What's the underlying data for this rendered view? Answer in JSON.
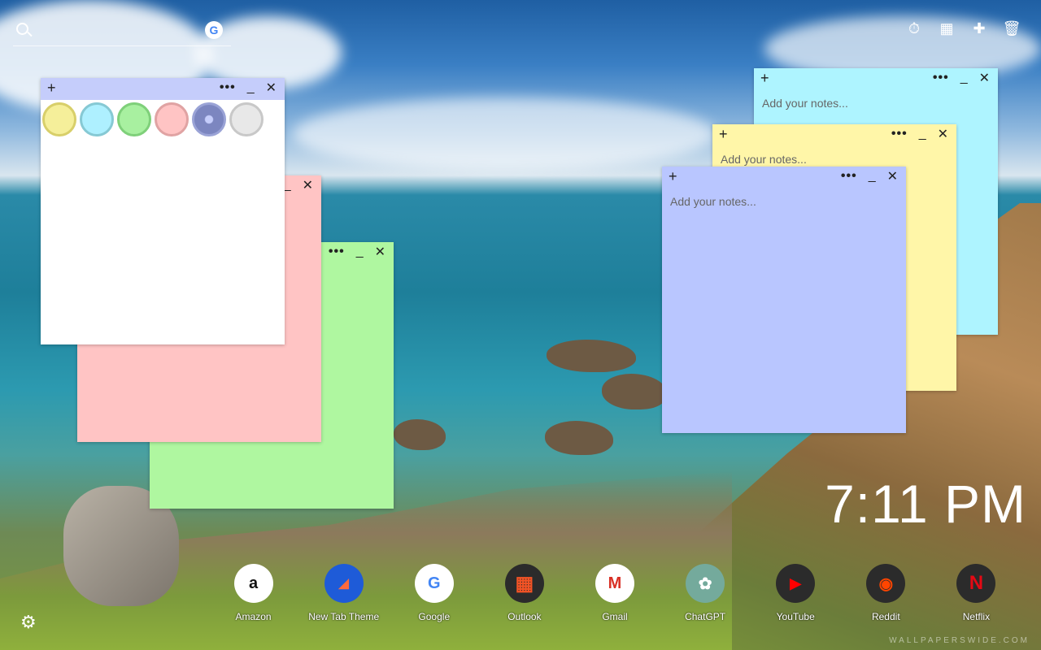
{
  "search": {
    "placeholder": ""
  },
  "top_icons": [
    "timer-icon",
    "calculator-icon",
    "new-note-icon",
    "trash-icon"
  ],
  "notes": [
    {
      "color": "#b9c6ff",
      "placeholder": "Add your notes...",
      "value": ""
    },
    {
      "color": "#fff6a8",
      "placeholder": "Add your notes...",
      "value": ""
    },
    {
      "color": "#aef4ff",
      "placeholder": "Add your notes...",
      "value": ""
    },
    {
      "color": "#aff7a0",
      "placeholder": "",
      "value": ""
    },
    {
      "color": "#ffc4c4",
      "placeholder": "",
      "value": ""
    },
    {
      "color": "#ffffff",
      "placeholder": "",
      "value": ""
    }
  ],
  "note_controls": {
    "plus": "+",
    "menu": "•••",
    "minimize": "_",
    "close": "✕"
  },
  "swatch_colors": [
    "#f5ef9a",
    "#aef0ff",
    "#a8f0a0",
    "#ffc4c4",
    "#7c86c0",
    "#e8e8e8"
  ],
  "clock": {
    "time": "7:11 PM"
  },
  "dock": {
    "apps": [
      {
        "label": "Amazon",
        "glyph": "a"
      },
      {
        "label": "New Tab Theme",
        "glyph": "◢"
      },
      {
        "label": "Google",
        "glyph": "G"
      },
      {
        "label": "Outlook",
        "glyph": "▦"
      },
      {
        "label": "Gmail",
        "glyph": "M"
      },
      {
        "label": "ChatGPT",
        "glyph": "✿"
      },
      {
        "label": "YouTube",
        "glyph": "▶"
      },
      {
        "label": "Reddit",
        "glyph": "◉"
      },
      {
        "label": "Netflix",
        "glyph": "N"
      }
    ]
  },
  "watermark": "WALLPAPERSWIDE.COM"
}
